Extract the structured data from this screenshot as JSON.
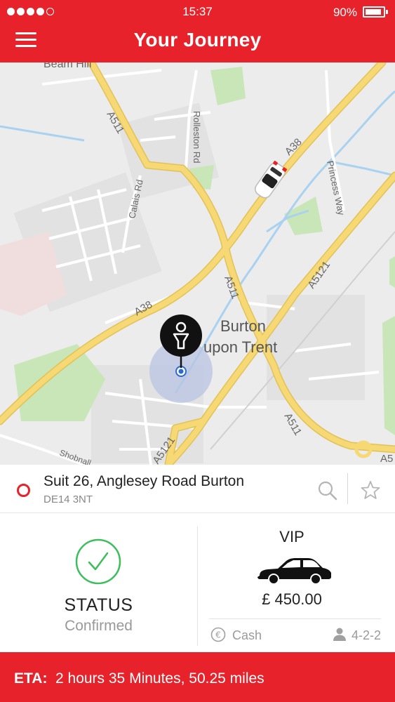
{
  "status_bar": {
    "signal_bars": 4,
    "signal_total": 5,
    "time": "15:37",
    "battery_percent": "90%",
    "battery_level": 0.9
  },
  "header": {
    "title": "Your Journey",
    "menu_icon": "hamburger-menu-icon"
  },
  "map": {
    "labels": {
      "beam_hill": "Beam Hill",
      "a511_north": "A511",
      "rolleston_rd": "Rolleston Rd",
      "calais_rd": "Calais Rd",
      "a38_north": "A38",
      "princess_way": "Princess Way",
      "a5121_east": "A5121",
      "a511_center": "A511",
      "a38_center": "A38",
      "town_line1": "Burton",
      "town_line2": "upon Trent",
      "a511_south": "A511",
      "a5121_south": "A5121",
      "shobnall": "Shobnall",
      "a5_edge": "A5"
    },
    "pin_icon": "person-pin-icon",
    "vehicle_icon": "car-icon",
    "colors": {
      "road_major": "#f5d66e",
      "road_minor": "#ffffff",
      "park": "#c5e5b3",
      "water": "#aad3f2",
      "land": "#eeeeee",
      "location_halo": "#b8c4e2",
      "location_dot": "#2b6bd3"
    }
  },
  "pickup": {
    "address_line1": "Suit 26, Anglesey Road Burton",
    "address_line2": "DE14 3NT",
    "search_icon": "search-icon",
    "favorite_icon": "star-icon"
  },
  "booking_status": {
    "icon": "checkmark-circle-icon",
    "label": "STATUS",
    "value": "Confirmed"
  },
  "vehicle": {
    "class": "VIP",
    "icon": "sedan-car-icon",
    "price": "£ 450.00",
    "payment_icon": "euro-coin-icon",
    "payment_method": "Cash",
    "capacity_icon": "person-icon",
    "capacity": "4-2-2"
  },
  "eta": {
    "label": "ETA:",
    "value": "2 hours 35 Minutes, 50.25 miles"
  },
  "colors": {
    "brand_red": "#e8222a",
    "success_green": "#3cbf5a",
    "muted_text": "#999999"
  }
}
